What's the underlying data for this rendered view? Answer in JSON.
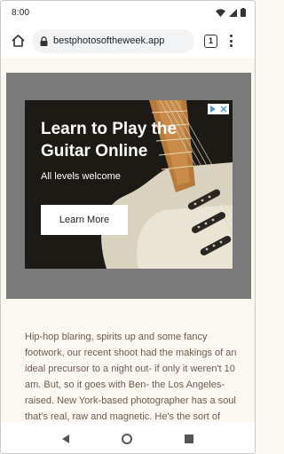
{
  "status_bar": {
    "time": "8:00",
    "icons": [
      "wifi-icon",
      "signal-icon",
      "battery-icon"
    ]
  },
  "toolbar": {
    "url": "bestphotosoftheweek.app",
    "tab_count": "1"
  },
  "ad": {
    "headline": "Learn to Play the Guitar Online",
    "subtitle": "All levels welcome",
    "cta_label": "Learn More",
    "colors": {
      "background": "#1d1a16",
      "guitar_body": "#d7cfb8",
      "fretboard": "#b57a3c"
    }
  },
  "article": {
    "text": "Hip-hop blaring, spirits up and some fancy footwork, our recent shoot had the makings of an ideal precursor to a night out- if only it weren't 10 am. But, so it goes with Ben- the Los Angeles-raised. New York-based photographer has a soul that's real, raw and magnetic. He's the sort of"
  },
  "navbar": {
    "icons": [
      "back-icon",
      "home-icon",
      "recents-icon"
    ]
  }
}
